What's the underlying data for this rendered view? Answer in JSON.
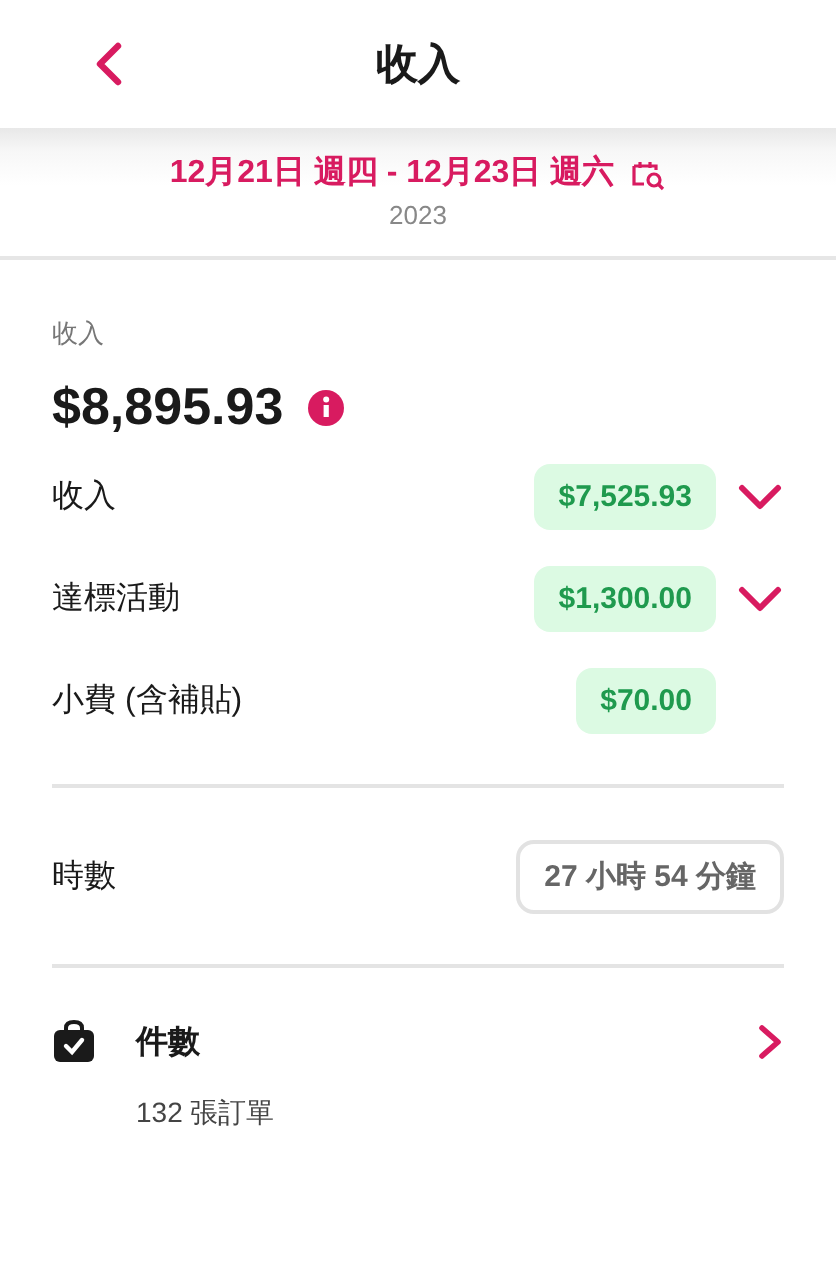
{
  "header": {
    "title": "收入"
  },
  "date_range": {
    "range": "12月21日 週四 - 12月23日 週六",
    "year": "2023"
  },
  "summary": {
    "label": "收入",
    "total": "$8,895.93"
  },
  "breakdown": [
    {
      "label": "收入",
      "amount": "$7,525.93",
      "kind": "expandable"
    },
    {
      "label": "達標活動",
      "amount": "$1,300.00",
      "kind": "expandable"
    },
    {
      "label": "小費 (含補貼)",
      "amount": "$70.00",
      "kind": "plain"
    }
  ],
  "hours": {
    "label": "時數",
    "value": "27 小時 54 分鐘"
  },
  "orders": {
    "label": "件數",
    "subtitle": "132 張訂單"
  }
}
